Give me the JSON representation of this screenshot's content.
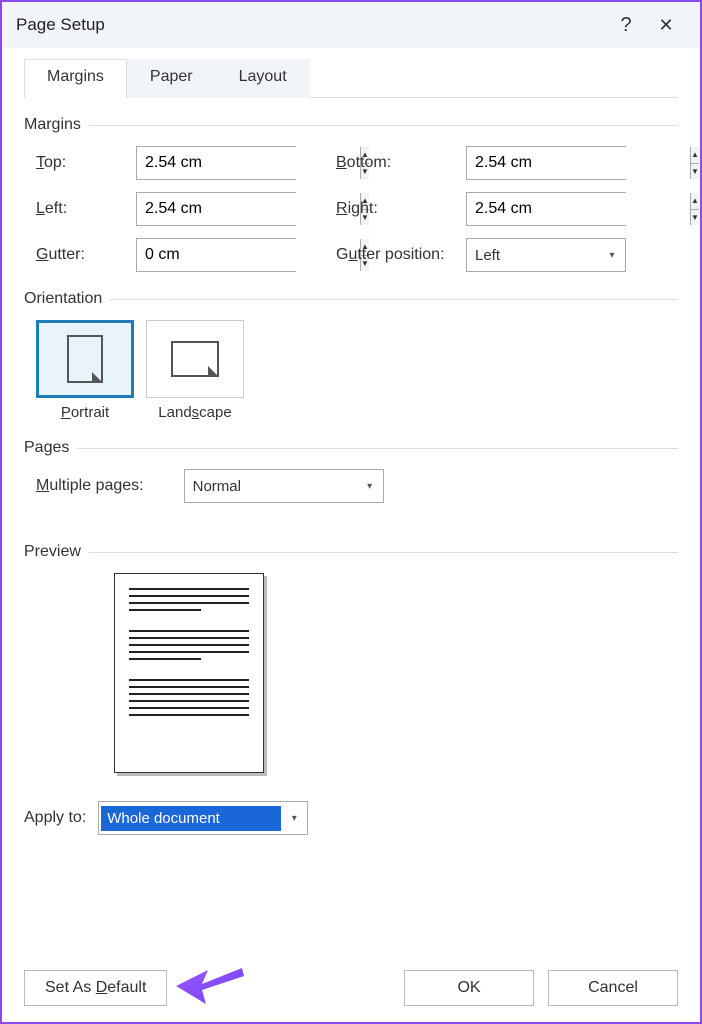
{
  "window": {
    "title": "Page Setup"
  },
  "tabs": {
    "margins": "Margins",
    "paper": "Paper",
    "layout": "Layout"
  },
  "margins": {
    "header": "Margins",
    "top_label": "Top:",
    "top_value": "2.54 cm",
    "bottom_label": "Bottom:",
    "bottom_value": "2.54 cm",
    "left_label": "Left:",
    "left_value": "2.54 cm",
    "right_label": "Right:",
    "right_value": "2.54 cm",
    "gutter_label": "Gutter:",
    "gutter_value": "0 cm",
    "gutter_pos_label": "Gutter position:",
    "gutter_pos_value": "Left"
  },
  "orientation": {
    "header": "Orientation",
    "portrait": "Portrait",
    "landscape": "Landscape"
  },
  "pages": {
    "header": "Pages",
    "multiple_label": "Multiple pages:",
    "multiple_value": "Normal"
  },
  "preview": {
    "header": "Preview"
  },
  "apply": {
    "label": "Apply to:",
    "value": "Whole document"
  },
  "buttons": {
    "default": "Set As Default",
    "ok": "OK",
    "cancel": "Cancel"
  }
}
